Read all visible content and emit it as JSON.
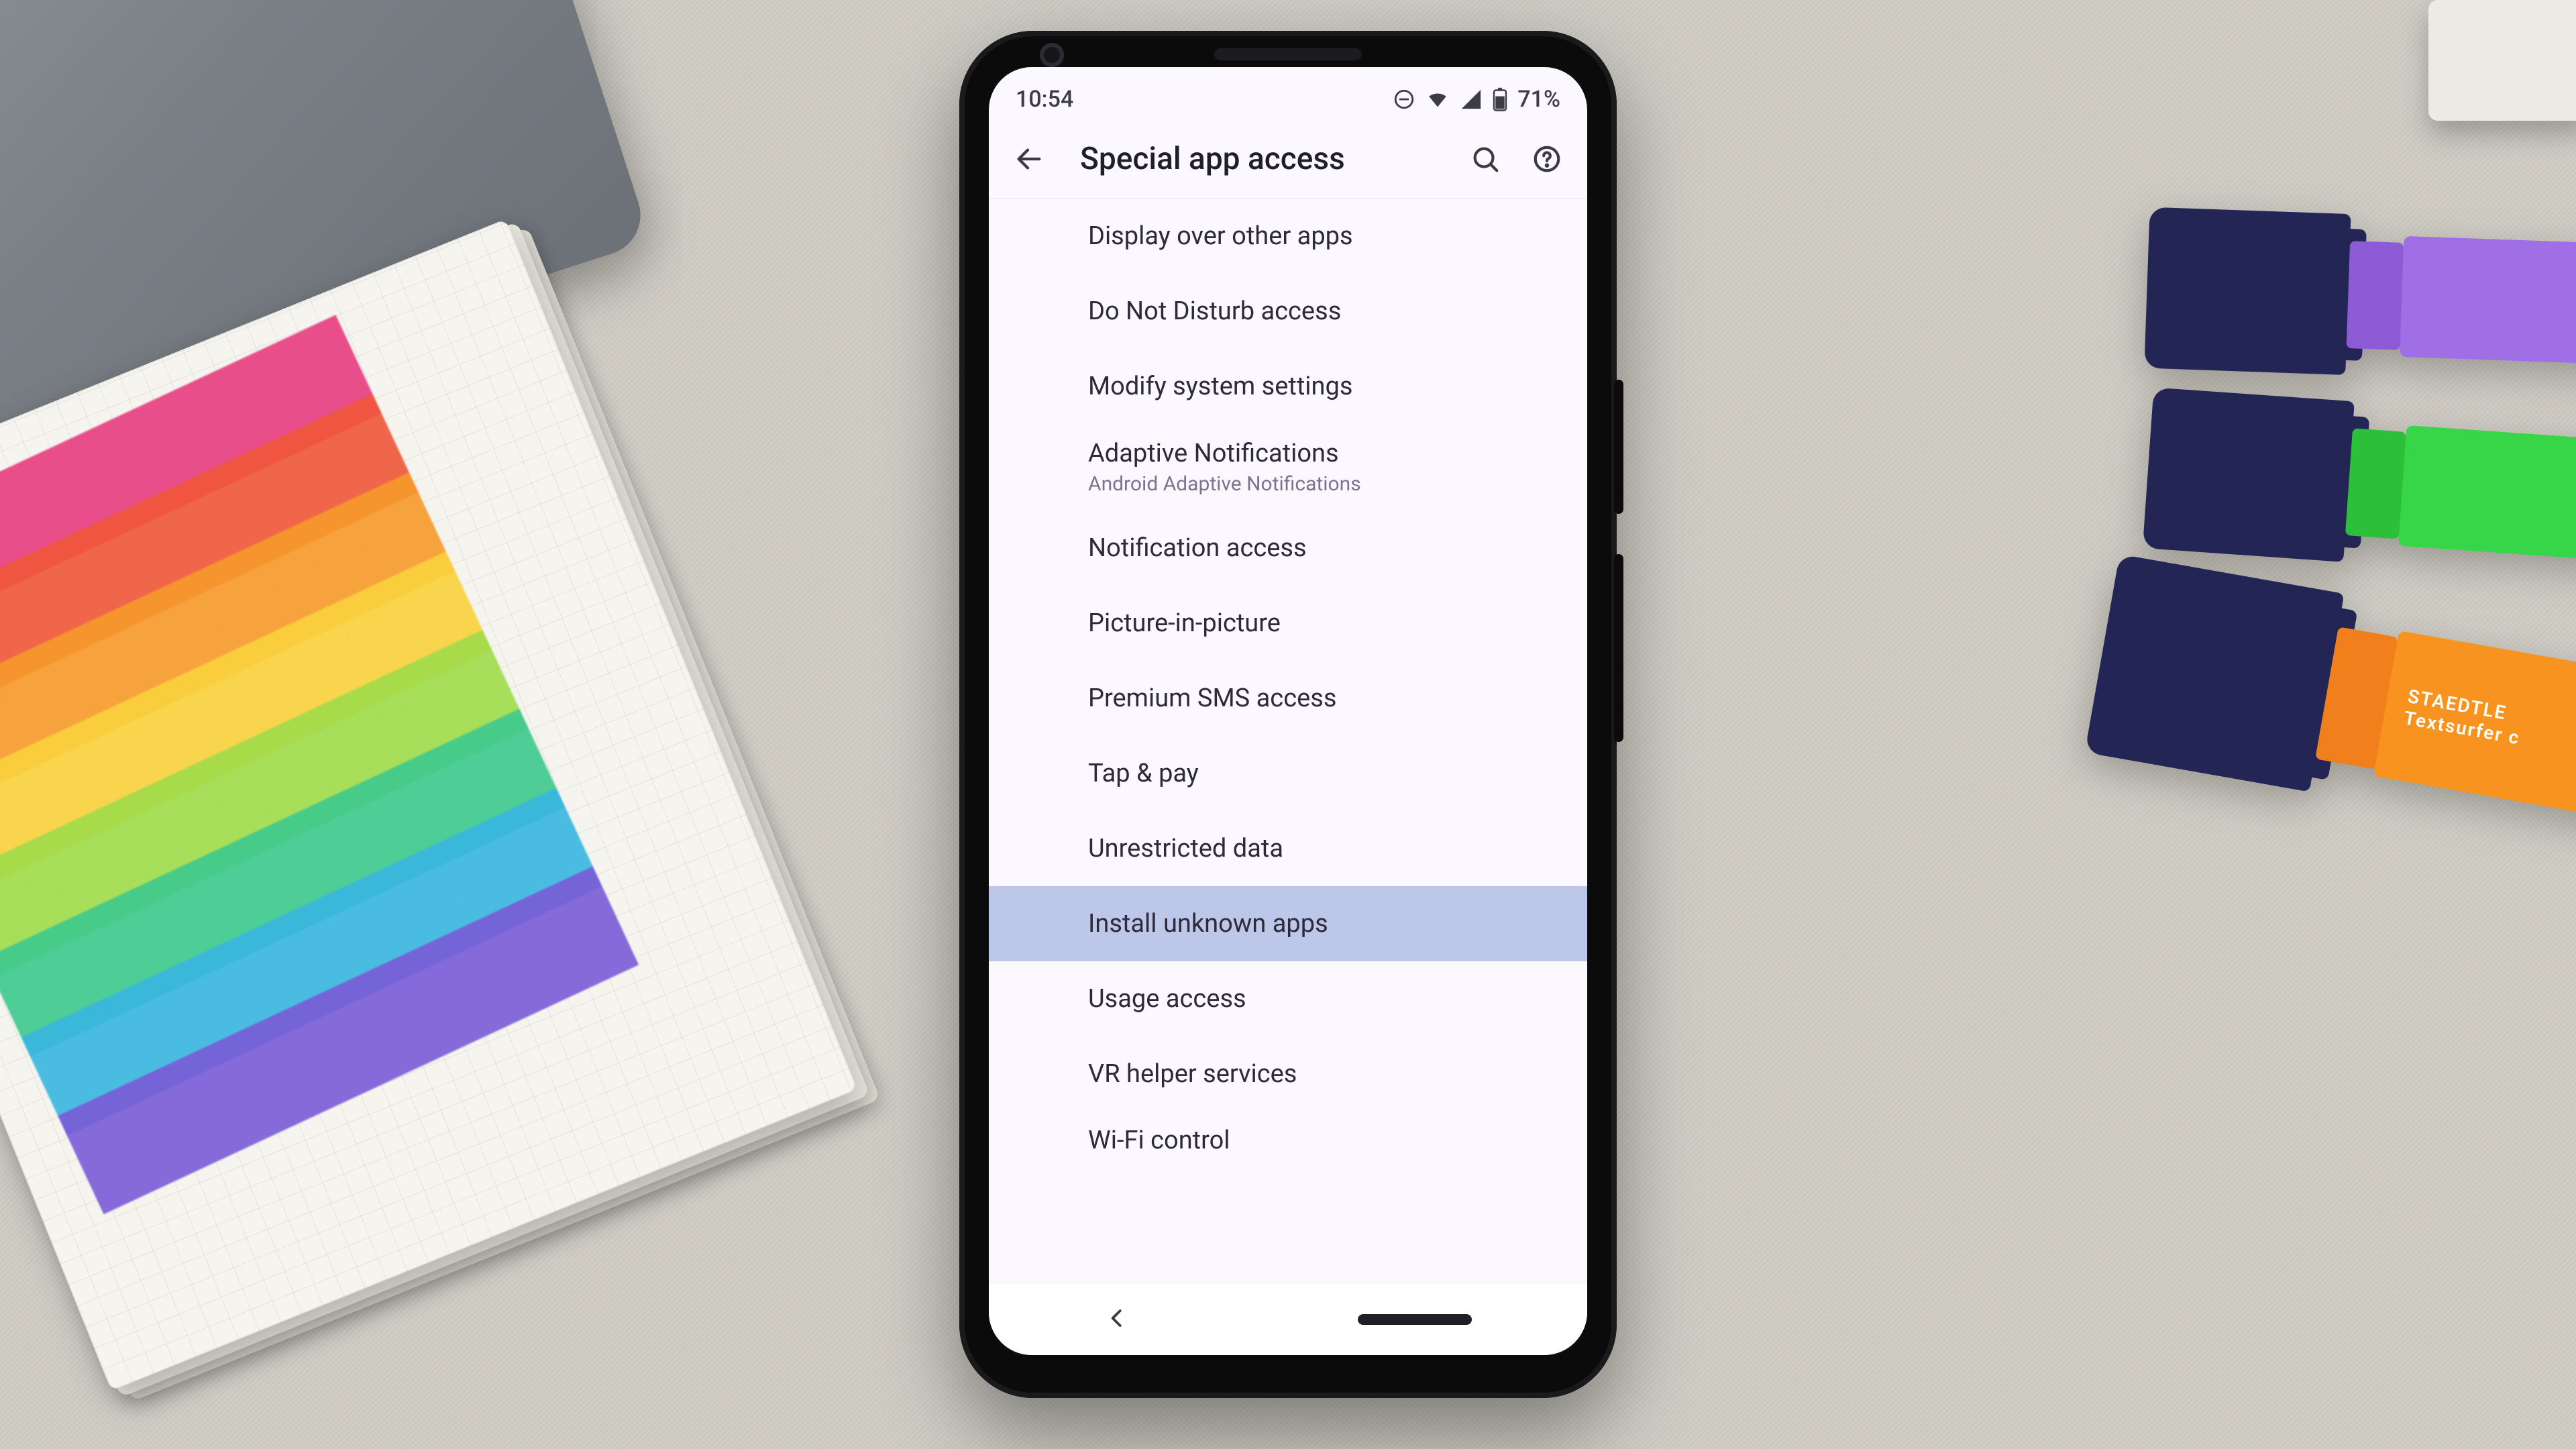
{
  "statusbar": {
    "time": "10:54",
    "battery_text": "71%"
  },
  "appbar": {
    "title": "Special app access"
  },
  "settings": {
    "items": [
      {
        "label": "Display over other apps"
      },
      {
        "label": "Do Not Disturb access"
      },
      {
        "label": "Modify system settings"
      },
      {
        "label": "Adaptive Notifications",
        "sub": "Android Adaptive Notifications"
      },
      {
        "label": "Notification access"
      },
      {
        "label": "Picture-in-picture"
      },
      {
        "label": "Premium SMS access"
      },
      {
        "label": "Tap & pay"
      },
      {
        "label": "Unrestricted data"
      },
      {
        "label": "Install unknown apps",
        "highlighted": true
      },
      {
        "label": "Usage access"
      },
      {
        "label": "VR helper services"
      },
      {
        "label": "Wi-Fi control"
      }
    ]
  },
  "marker_brand": {
    "name": "STAEDTLE",
    "line": "Textsurfer c"
  }
}
